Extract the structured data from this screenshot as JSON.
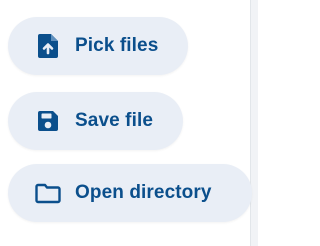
{
  "buttons": {
    "pick_files": {
      "label": "Pick files",
      "icon": "file-upload-icon"
    },
    "save_file": {
      "label": "Save file",
      "icon": "save-floppy-icon"
    },
    "open_directory": {
      "label": "Open directory",
      "icon": "folder-icon"
    }
  },
  "colors": {
    "button_background": "#e9eef6",
    "accent": "#0b4f8c"
  }
}
